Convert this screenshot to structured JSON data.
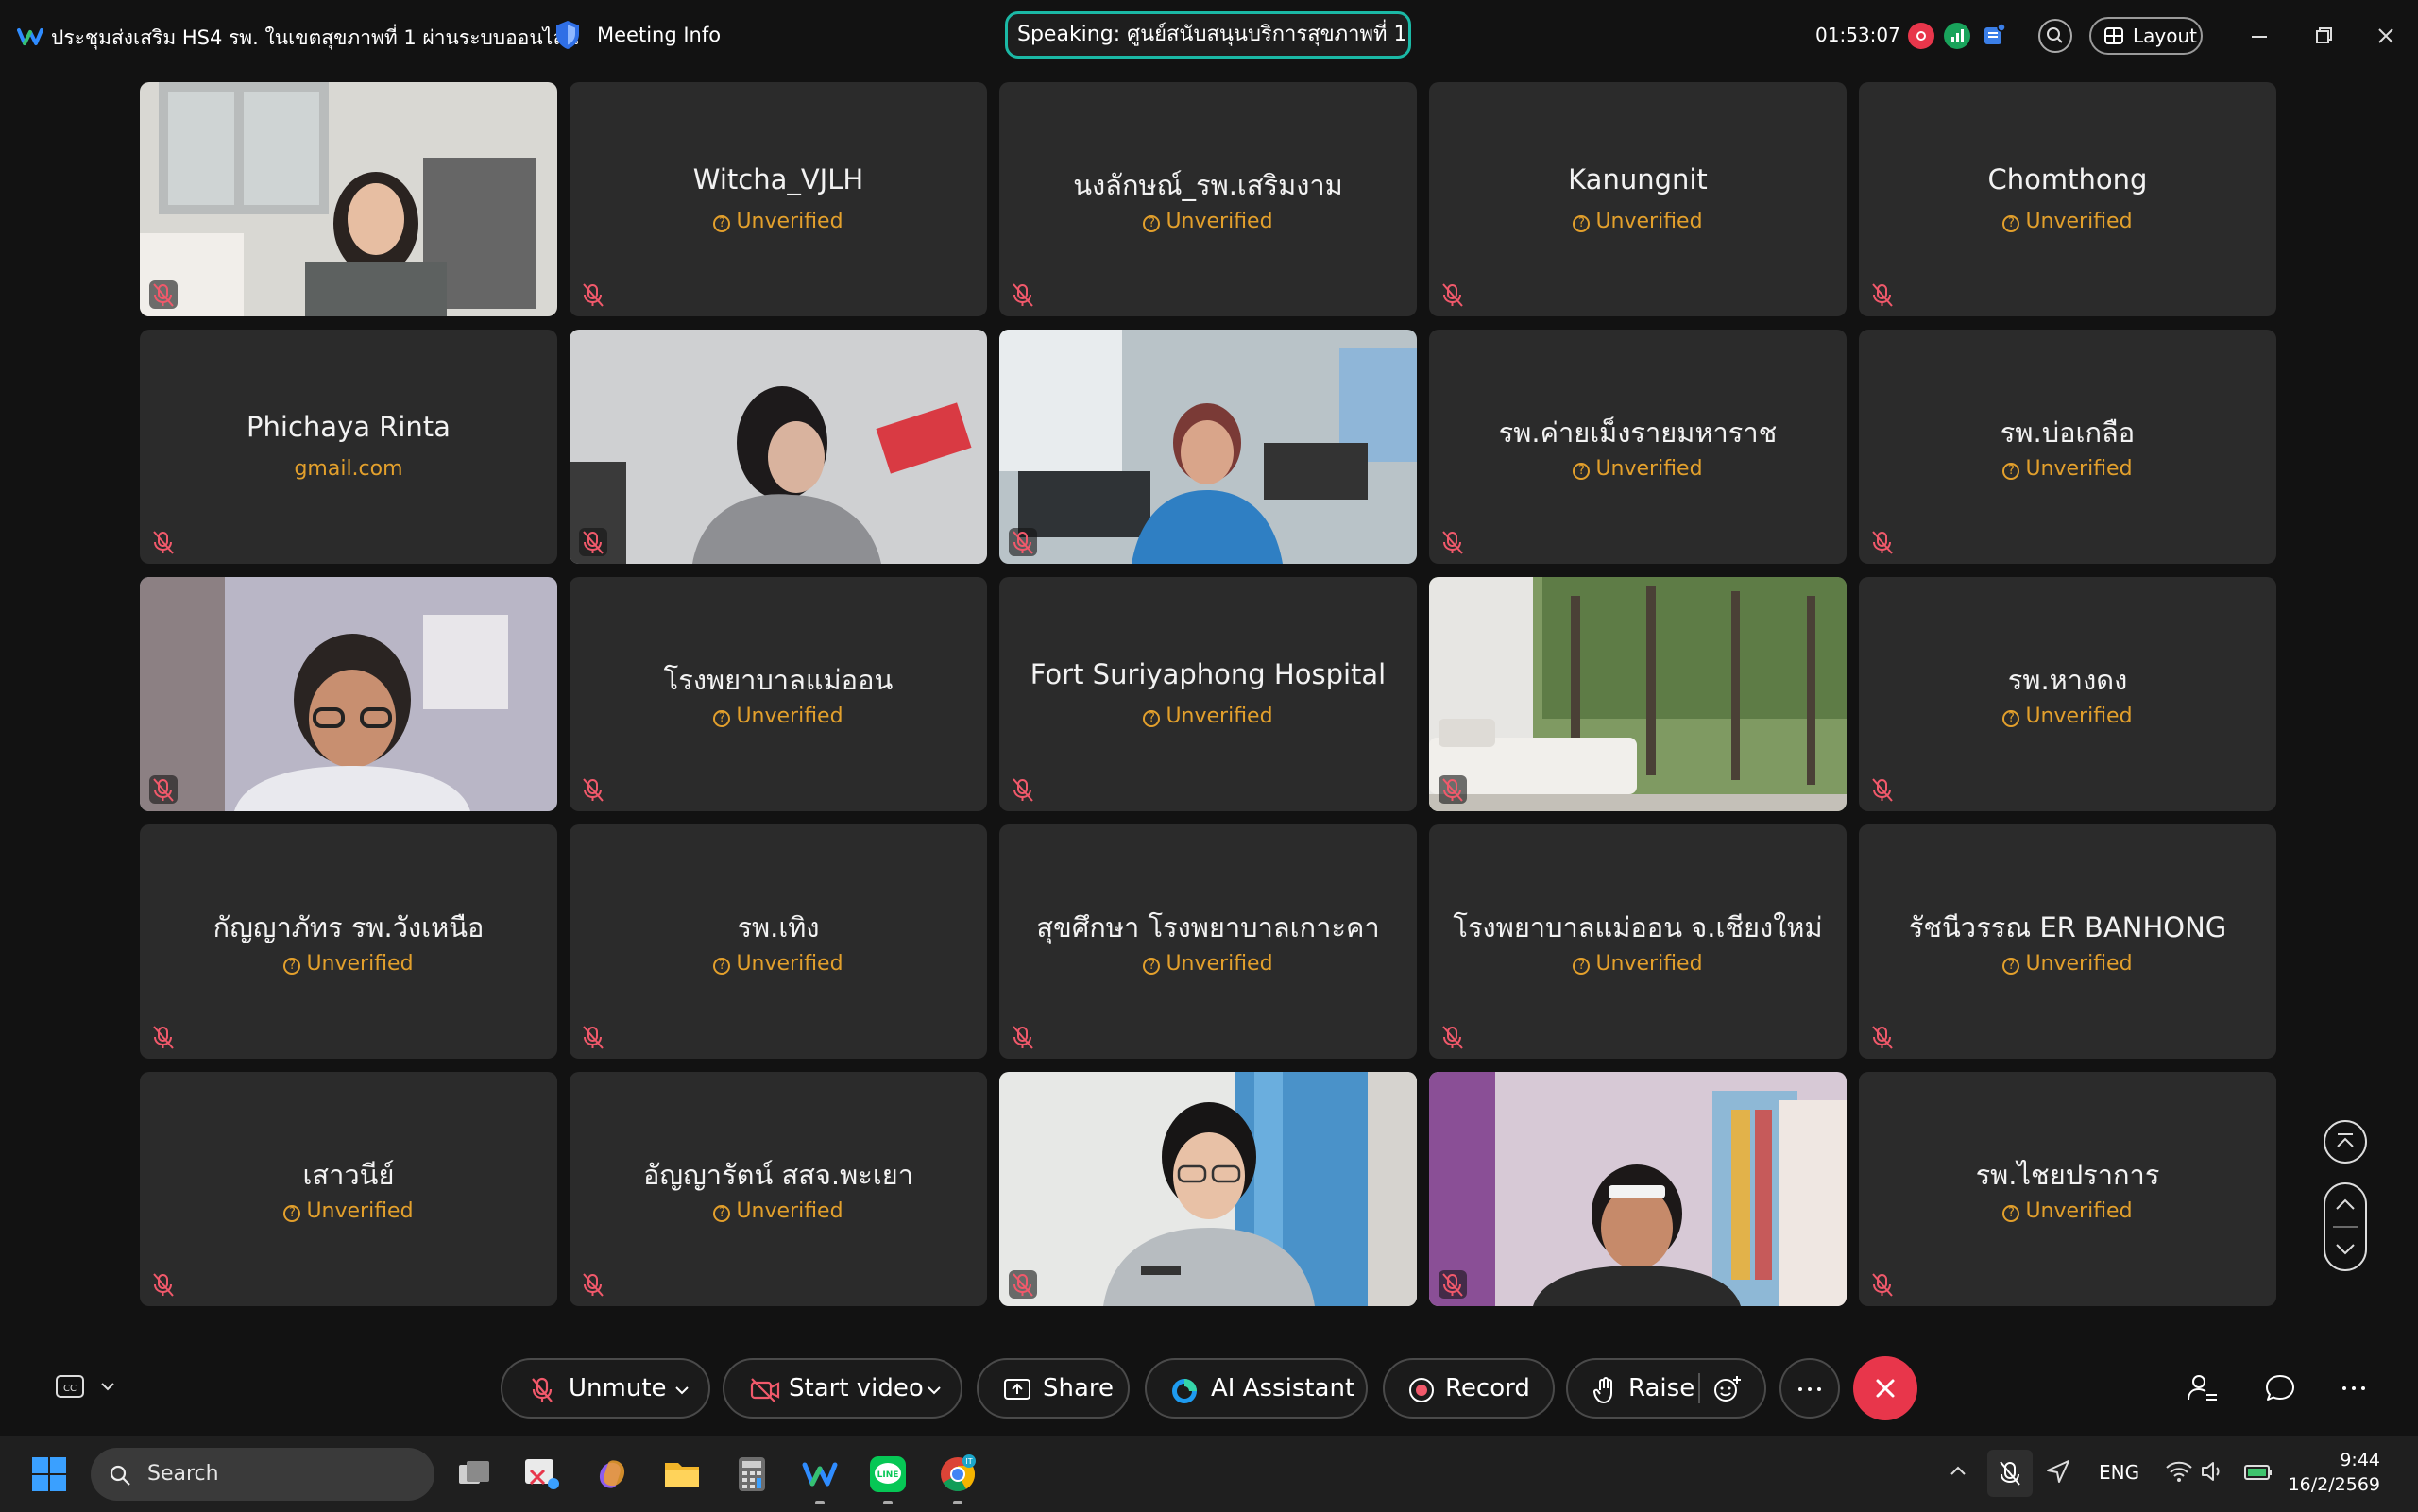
{
  "titlebar": {
    "meeting_title": "ประชุมส่งเสริม HS4 รพ. ในเขตสุขภาพที่ 1 ผ่านระบบออนไลน์",
    "meeting_info_label": "Meeting Info",
    "speaking": "Speaking: ศูนย์สนับสนุนบริการสุขภาพที่ 1",
    "timer": "01:53:07",
    "layout_label": "Layout"
  },
  "tiles": [
    {
      "name": "",
      "sub": "",
      "video": true
    },
    {
      "name": "Witcha_VJLH",
      "sub": "Unverified"
    },
    {
      "name": "นงลักษณ์_รพ.เสริมงาม",
      "sub": "Unverified"
    },
    {
      "name": "Kanungnit",
      "sub": "Unverified"
    },
    {
      "name": "Chomthong",
      "sub": "Unverified"
    },
    {
      "name": "Phichaya Rinta",
      "sub": "gmail.com"
    },
    {
      "name": "",
      "sub": "",
      "video": true
    },
    {
      "name": "",
      "sub": "",
      "video": true
    },
    {
      "name": "รพ.ค่ายเม็งรายมหาราช",
      "sub": "Unverified"
    },
    {
      "name": "รพ.บ่อเกลือ",
      "sub": "Unverified"
    },
    {
      "name": "",
      "sub": "",
      "video": true
    },
    {
      "name": "โรงพยาบาลแม่ออน",
      "sub": "Unverified"
    },
    {
      "name": "Fort Suriyaphong Hospital",
      "sub": "Unverified"
    },
    {
      "name": "",
      "sub": "",
      "video": true
    },
    {
      "name": "รพ.หางดง",
      "sub": "Unverified"
    },
    {
      "name": "กัญญาภัทร รพ.วังเหนือ",
      "sub": "Unverified"
    },
    {
      "name": "รพ.เทิง",
      "sub": "Unverified"
    },
    {
      "name": "สุขศึกษา โรงพยาบาลเกาะคา",
      "sub": "Unverified"
    },
    {
      "name": "โรงพยาบาลแม่ออน จ.เชียงใหม่",
      "sub": "Unverified"
    },
    {
      "name": "รัชนีวรรณ ER BANHONG",
      "sub": "Unverified"
    },
    {
      "name": "เสาวนีย์",
      "sub": "Unverified"
    },
    {
      "name": "อัญญารัตน์ สสจ.พะเยา",
      "sub": "Unverified"
    },
    {
      "name": "",
      "sub": "",
      "video": true
    },
    {
      "name": "",
      "sub": "",
      "video": true
    },
    {
      "name": "รพ.ไชยปราการ",
      "sub": "Unverified"
    }
  ],
  "toolbar": {
    "unmute": "Unmute",
    "start_video": "Start video",
    "share": "Share",
    "ai_assistant": "AI Assistant",
    "record": "Record",
    "raise": "Raise"
  },
  "taskbar": {
    "search_placeholder": "Search",
    "language": "ENG",
    "time": "9:44",
    "date": "16/2/2569"
  },
  "colors": {
    "unverified": "#e3a02c",
    "tile_bg": "#2b2b2b",
    "end_call": "#e8364b",
    "speaking_border": "#1bb9a6"
  }
}
